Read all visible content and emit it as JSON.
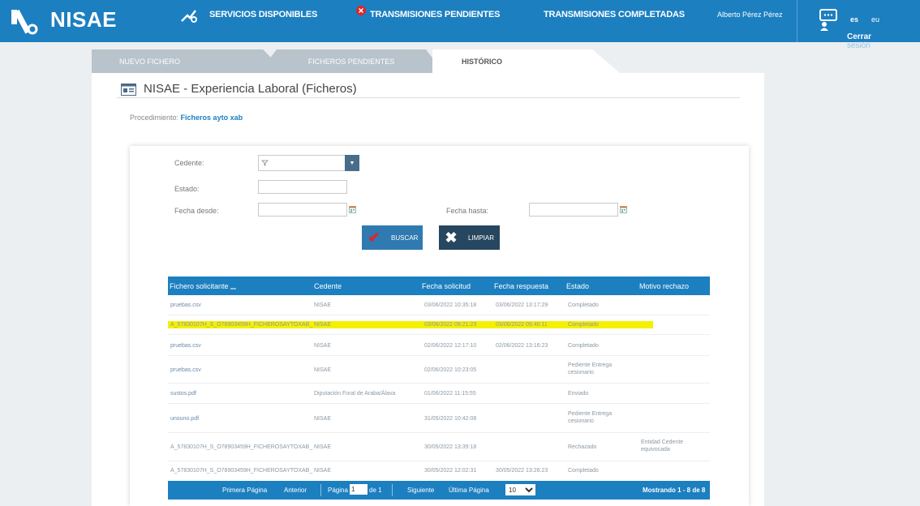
{
  "header": {
    "app_name": "NISAE",
    "nav": [
      {
        "label": "SERVICIOS DISPONIBLES"
      },
      {
        "label": "TRANSMISIONES PENDIENTES"
      },
      {
        "label": "TRANSMISIONES COMPLETADAS"
      }
    ],
    "user_name": "Alberto Pérez Pérez",
    "lang_es": "es",
    "lang_eu": "eu",
    "logout_line1": "Cerrar",
    "logout_line2": "sesión",
    "accent": "#1c7fc0"
  },
  "tabs": [
    {
      "label": "NUEVO FICHERO"
    },
    {
      "label": "FICHEROS PENDIENTES"
    },
    {
      "label": "HISTÓRICO"
    }
  ],
  "page": {
    "title": "NISAE - Experiencia Laboral (Ficheros)",
    "procedure_label": "Procedimiento:",
    "procedure_value": "Ficheros ayto xab"
  },
  "filters": {
    "cedente_label": "Cedente:",
    "estado_label": "Estado:",
    "fecha_desde_label": "Fecha desde:",
    "fecha_hasta_label": "Fecha hasta:",
    "buscar_label": "BUSCAR",
    "limpiar_label": "LIMPIAR"
  },
  "table": {
    "headers": [
      "Fichero solicitante",
      "Cedente",
      "Fecha solicitud",
      "Fecha respuesta",
      "Estado",
      "Motivo rechazo"
    ],
    "rows": [
      {
        "file": "pruebas.csv",
        "cedente": "NISAE",
        "fsol": "03/06/2022 10:35:18",
        "fresp": "03/06/2022 13:17:29",
        "estado": "Completado",
        "motivo": ""
      },
      {
        "file": "A_57830107H_S_O78903459H_FICHEROSAYTOXAB_",
        "cedente": "NISAE",
        "fsol": "03/06/2022 09:21:23",
        "fresp": "03/06/2022 09:40:11",
        "estado": "Completado",
        "motivo": "",
        "highlight": true
      },
      {
        "file": "pruebas.csv",
        "cedente": "NISAE",
        "fsol": "02/06/2022 12:17:10",
        "fresp": "02/06/2022 13:16:23",
        "estado": "Completado",
        "motivo": ""
      },
      {
        "file": "pruebas.csv",
        "cedente": "NISAE",
        "fsol": "02/06/2022 10:23:05",
        "fresp": "",
        "estado": "Pediente Entrega cesionario",
        "motivo": ""
      },
      {
        "file": "sustos.pdf",
        "cedente": "Diputación Foral de Araba/Álava",
        "fsol": "01/06/2022 11:15:55",
        "fresp": "",
        "estado": "Enviado",
        "motivo": ""
      },
      {
        "file": "unouno.pdf",
        "cedente": "NISAE",
        "fsol": "31/05/2022 10:42:08",
        "fresp": "",
        "estado": "Pediente Entrega cesionario",
        "motivo": ""
      },
      {
        "file": "A_57830107H_S_O78903459H_FICHEROSAYTOXAB_",
        "cedente": "NISAE",
        "fsol": "30/05/2022 13:39:18",
        "fresp": "",
        "estado": "Rechazado",
        "motivo": "Entidad Cedente equivocada"
      },
      {
        "file": "A_57830107H_S_O78903459H_FICHEROSAYTOXAB_",
        "cedente": "NISAE",
        "fsol": "30/05/2022 12:02:31",
        "fresp": "30/05/2022 13:26:23",
        "estado": "Completado",
        "motivo": ""
      }
    ]
  },
  "pagination": {
    "first": "Primera Página",
    "prev": "Anterior",
    "page_label": "Página",
    "page_value": "1",
    "of": "de 1",
    "next": "Siguiente",
    "last": "Última Página",
    "page_size": "10",
    "showing": "Mostrando 1 - 8 de 8"
  }
}
